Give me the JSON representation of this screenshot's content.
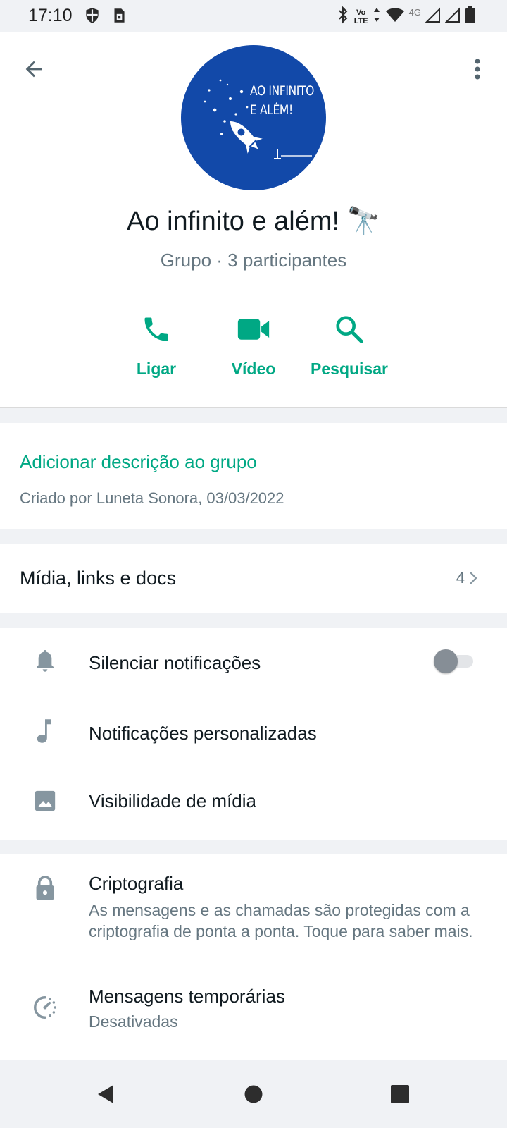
{
  "status_bar": {
    "time": "17:10",
    "volte_top": "Vo",
    "volte_bottom": "LTE",
    "network": "4G",
    "icons": [
      "shield-icon",
      "sim-icon",
      "bluetooth-icon",
      "volte-icon",
      "data-arrows-icon",
      "wifi-icon",
      "signal-icon",
      "signal-icon",
      "battery-icon"
    ]
  },
  "header": {
    "avatar": {
      "line1": "AO INFINITO",
      "line2": "E ALÉM!",
      "bg_color": "#1249a9"
    },
    "title": "Ao infinito e além! 🔭",
    "subtitle": "Grupo · 3 participantes",
    "actions": [
      {
        "label": "Ligar",
        "icon": "phone-icon"
      },
      {
        "label": "Vídeo",
        "icon": "video-icon"
      },
      {
        "label": "Pesquisar",
        "icon": "search-icon"
      }
    ]
  },
  "description": {
    "add_label": "Adicionar descrição ao grupo",
    "created_by": "Criado por Luneta Sonora, 03/03/2022"
  },
  "media": {
    "label": "Mídia, links e docs",
    "count": "4"
  },
  "settings": [
    {
      "label": "Silenciar notificações",
      "icon": "bell-icon",
      "toggle": false
    },
    {
      "label": "Notificações personalizadas",
      "icon": "music-note-icon"
    },
    {
      "label": "Visibilidade de mídia",
      "icon": "image-icon"
    }
  ],
  "security": [
    {
      "label": "Criptografia",
      "sub": "As mensagens e as chamadas são protegidas com a criptografia de ponta a ponta. Toque para saber mais.",
      "icon": "lock-icon"
    },
    {
      "label": "Mensagens temporárias",
      "sub": "Desativadas",
      "icon": "timer-icon"
    }
  ],
  "colors": {
    "accent": "#00a884",
    "secondary_text": "#667781",
    "icon_gray": "#8696a0"
  }
}
